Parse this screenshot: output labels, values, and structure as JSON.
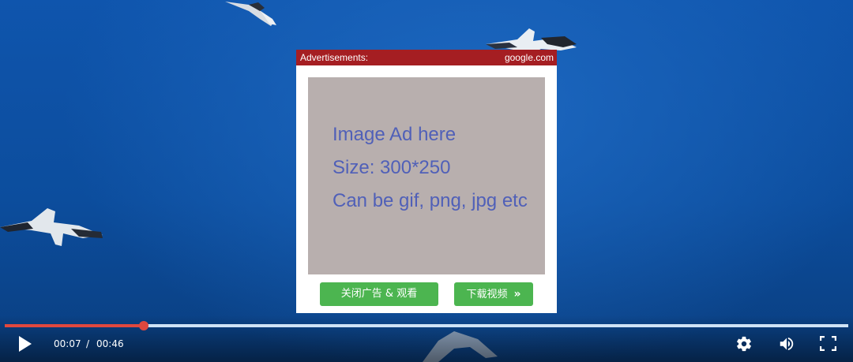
{
  "player": {
    "current_time": "00:07",
    "separator": "/",
    "duration": "00:46",
    "progress_fraction": 0.165,
    "accent_color": "#e0483e",
    "icons": [
      "play-icon",
      "settings-icon",
      "volume-icon",
      "fullscreen-icon"
    ]
  },
  "ad": {
    "header_left": "Advertisements:",
    "header_right": "google.com",
    "header_color": "#a51e22",
    "image_lines": [
      "Image Ad here",
      "Size: 300*250",
      "Can be gif, png, jpg etc"
    ],
    "image_bg": "#b8afae",
    "close_button_label": "关闭广告 & 观看",
    "download_button_label": "下载视频",
    "download_icon": "double-chevron-right-icon",
    "button_color": "#4cb550"
  }
}
